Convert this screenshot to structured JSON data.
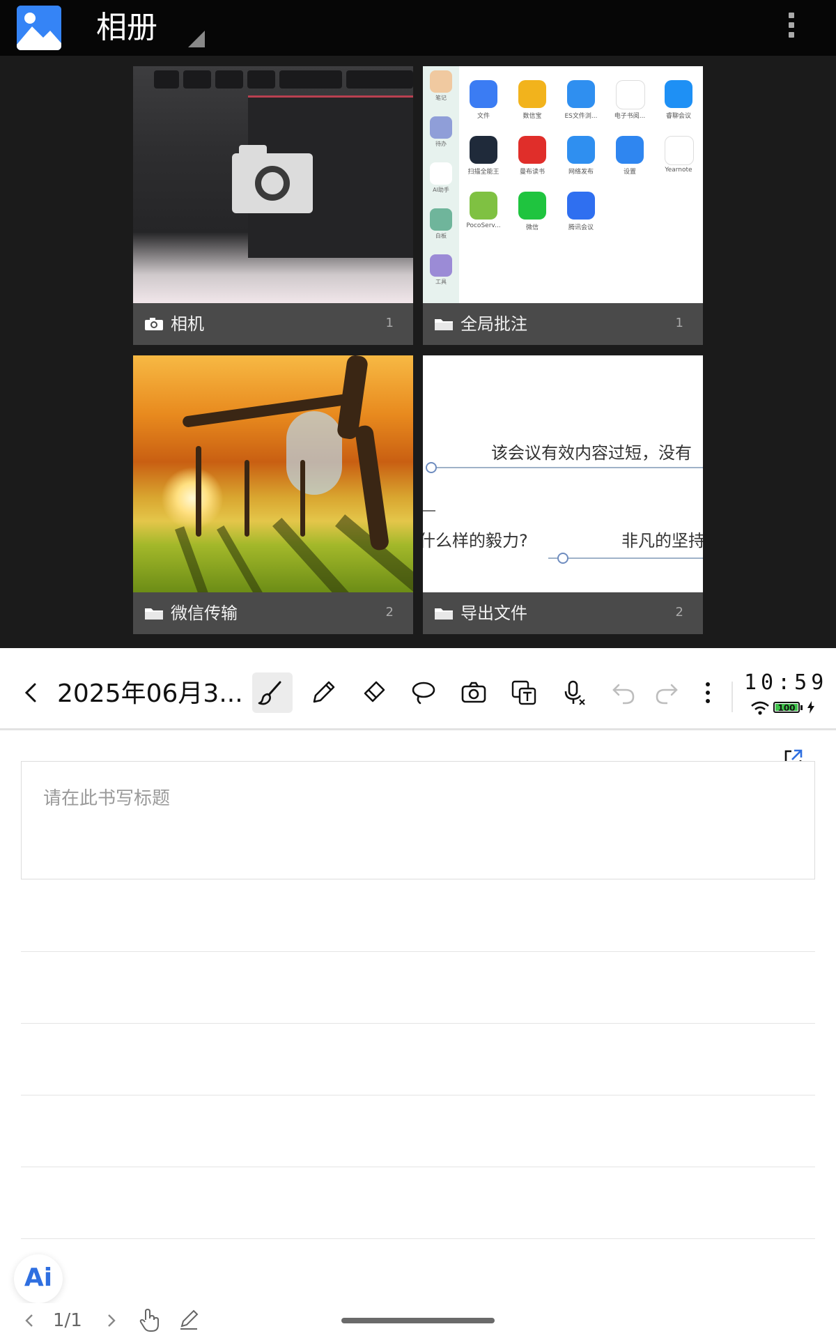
{
  "gallery": {
    "title": "相册",
    "albums": [
      {
        "name": "相机",
        "count": "1",
        "icon": "camera-icon"
      },
      {
        "name": "全局批注",
        "count": "1",
        "icon": "folder-icon"
      },
      {
        "name": "微信传输",
        "count": "2",
        "icon": "folder-icon"
      },
      {
        "name": "导出文件",
        "count": "2",
        "icon": "folder-icon"
      }
    ],
    "annot_apps": [
      {
        "label": "文件",
        "color": "#3b7cf3"
      },
      {
        "label": "数信宝",
        "color": "#f2b31c"
      },
      {
        "label": "ES文件浏...",
        "color": "#2f8ff0"
      },
      {
        "label": "电子书阅...",
        "color": "#ffffff"
      },
      {
        "label": "睿聊会议",
        "color": "#1e90f5"
      },
      {
        "label": "扫描全能王",
        "color": "#1f2a3a"
      },
      {
        "label": "曼布读书",
        "color": "#e02e2a"
      },
      {
        "label": "网络发布",
        "color": "#2f8ff0"
      },
      {
        "label": "设置",
        "color": "#2f86f0"
      },
      {
        "label": "Yearnote",
        "color": "#ffffff"
      },
      {
        "label": "PocoServ...",
        "color": "#7fc142"
      },
      {
        "label": "微信",
        "color": "#1fc43f"
      },
      {
        "label": "腾讯会议",
        "color": "#2f6ff0"
      }
    ],
    "annot_sidebar_labels": [
      "笔记",
      "待办",
      "AI助手",
      "白板",
      "工具"
    ],
    "export_preview": {
      "line1": "该会议有效内容过短，没有",
      "line2_left": "什么样的毅力?",
      "line2_right": "非凡的坚持"
    }
  },
  "toolbar": {
    "title": "2025年06月3...",
    "tools": [
      "brush",
      "pen",
      "eraser",
      "lasso",
      "camera",
      "ocr",
      "voice",
      "undo",
      "redo",
      "more"
    ]
  },
  "status": {
    "time": "10:59",
    "battery": "100"
  },
  "note": {
    "title_placeholder": "请在此书写标题"
  },
  "footer": {
    "page": "1/1",
    "ai_label": "Ai"
  }
}
